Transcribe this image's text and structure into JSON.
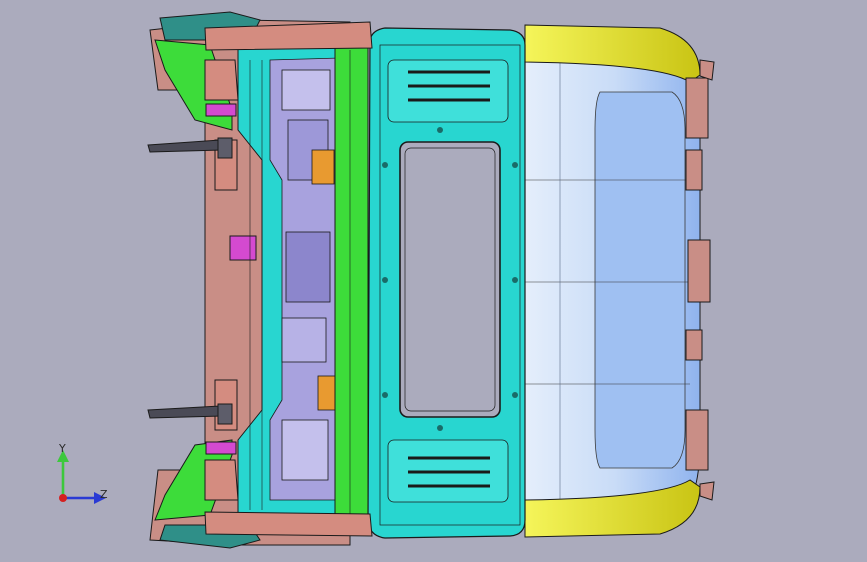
{
  "viewport": {
    "background": "#ababbd"
  },
  "model": {
    "colors": {
      "cyan": "#28d6d0",
      "cyan_dark": "#1aa8a4",
      "green": "#3ddc3a",
      "yellow": "#ecec28",
      "blue_light": "#d6e6fb",
      "blue_mid": "#8fb6f0",
      "salmon": "#d48c80",
      "magenta": "#d44ad0",
      "lavender": "#a8a2de",
      "teal_top": "#2f8f88",
      "outline": "#1a1a1a"
    }
  },
  "triad": {
    "y_label": "Y",
    "z_label": "Z",
    "y_color": "#3cc83c",
    "z_color": "#2a3ad4",
    "x_color": "#d42020"
  }
}
